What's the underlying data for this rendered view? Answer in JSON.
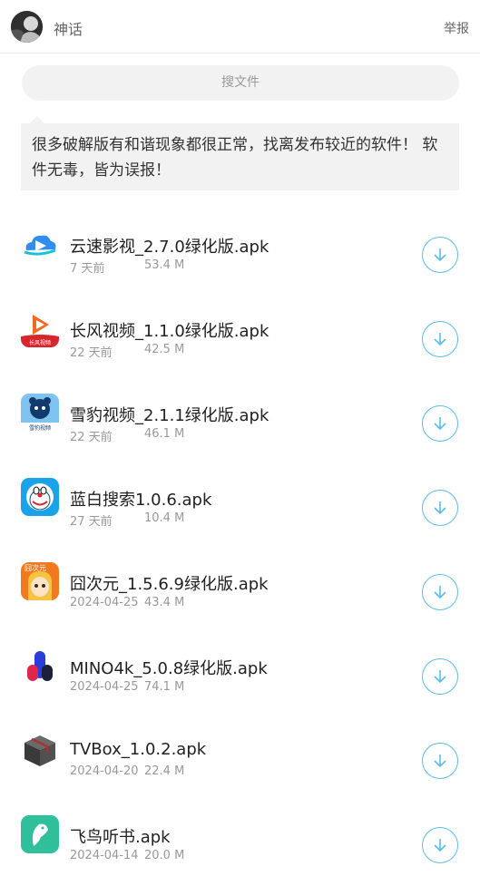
{
  "header": {
    "username": "神话",
    "report_label": "举报"
  },
  "search": {
    "placeholder": "搜文件"
  },
  "notice": {
    "text": "很多破解版有和谐现象都很正常，找离发布较近的软件！ 软件无毒，皆为误报！"
  },
  "files": [
    {
      "name": "云速影视_2.7.0绿化版.apk",
      "date": "7 天前",
      "size": "53.4 M",
      "icon": "cloud-video-app-icon"
    },
    {
      "name": "长风视频_1.1.0绿化版.apk",
      "date": "22 天前",
      "size": "42.5 M",
      "icon": "play-triangle-app-icon"
    },
    {
      "name": "雪豹视频_2.1.1绿化版.apk",
      "date": "22 天前",
      "size": "46.1 M",
      "icon": "leopard-app-icon"
    },
    {
      "name": "蓝白搜索1.0.6.apk",
      "date": "27 天前",
      "size": "10.4 M",
      "icon": "doraemon-app-icon"
    },
    {
      "name": "囧次元_1.5.6.9绿化版.apk",
      "date": "2024-04-25",
      "size": "43.4 M",
      "icon": "anime-girl-app-icon"
    },
    {
      "name": "MINO4k_5.0.8绿化版.apk",
      "date": "2024-04-25",
      "size": "74.1 M",
      "icon": "mino-logo-app-icon"
    },
    {
      "name": "TVBox_1.0.2.apk",
      "date": "2024-04-20",
      "size": "22.4 M",
      "icon": "box-app-icon"
    },
    {
      "name": "飞鸟听书.apk",
      "date": "2024-04-14",
      "size": "20.0 M",
      "icon": "bird-app-icon"
    }
  ],
  "colors": {
    "accent": "#5bbde9",
    "notice_bg": "#f2f2f2"
  }
}
